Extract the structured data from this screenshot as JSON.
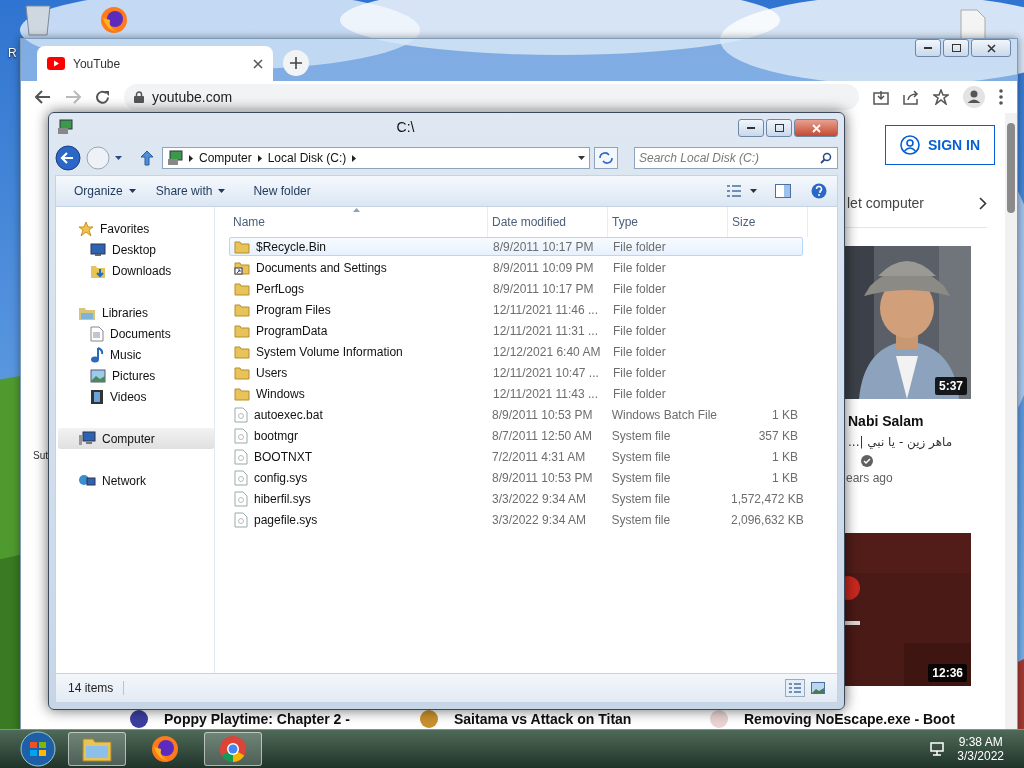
{
  "desktop": {
    "icons": [
      {
        "kind": "recycle-bin",
        "label": "R"
      },
      {
        "kind": "firefox"
      },
      {
        "kind": "document"
      }
    ]
  },
  "browser": {
    "tabs": [
      {
        "title": "YouTube",
        "selected": true
      }
    ],
    "address": "youtube.com",
    "sidebar_fragment": "Sut",
    "sign_in": "SIGN IN",
    "chip": "let computer",
    "videos": [
      {
        "kind": "portrait",
        "duration": "5:37",
        "title": "Nabi Salam",
        "subtitle": "ماهر زين - يا نبي |...",
        "verified": true,
        "meta": "ears ago"
      },
      {
        "kind": "dark",
        "duration": "12:36"
      }
    ],
    "recommendations": [
      {
        "title": "Poppy Playtime: Chapter 2 -",
        "color": "#3b3fa0"
      },
      {
        "title": "Saitama vs Attack on Titan",
        "color": "#c9912e"
      },
      {
        "title": "Removing NoEscape.exe - Boot",
        "color": "#e9d3d3"
      }
    ]
  },
  "explorer": {
    "title": "C:\\",
    "breadcrumb": [
      "Computer",
      "Local Disk (C:)"
    ],
    "search": {
      "placeholder": "Search Local Disk (C:)"
    },
    "commands": [
      {
        "label": "Organize",
        "dropdown": true
      },
      {
        "label": "Share with",
        "dropdown": true
      },
      {
        "label": "New folder",
        "dropdown": false
      }
    ],
    "nav": [
      {
        "label": "Favorites",
        "kind": "star",
        "selected": false,
        "children": [
          {
            "label": "Desktop",
            "kind": "desktop",
            "selected": false
          },
          {
            "label": "Downloads",
            "kind": "downloads",
            "selected": false
          }
        ]
      },
      {
        "label": "Libraries",
        "kind": "library",
        "selected": false,
        "children": [
          {
            "label": "Documents",
            "kind": "documents",
            "selected": false
          },
          {
            "label": "Music",
            "kind": "music",
            "selected": false
          },
          {
            "label": "Pictures",
            "kind": "pictures",
            "selected": false
          },
          {
            "label": "Videos",
            "kind": "videos",
            "selected": false
          }
        ]
      },
      {
        "label": "Computer",
        "kind": "computer",
        "selected": true
      },
      {
        "label": "Network",
        "kind": "network",
        "selected": false
      }
    ],
    "columns": [
      "Name",
      "Date modified",
      "Type",
      "Size"
    ],
    "rows": [
      {
        "kind": "folder",
        "name": "$Recycle.Bin",
        "date": "8/9/2011 10:17 PM",
        "type": "File folder",
        "selected": true
      },
      {
        "kind": "shortcut",
        "name": "Documents and Settings",
        "date": "8/9/2011 10:09 PM",
        "type": "File folder",
        "selected": false
      },
      {
        "kind": "folder",
        "name": "PerfLogs",
        "date": "8/9/2011 10:17 PM",
        "type": "File folder",
        "selected": false
      },
      {
        "kind": "folder",
        "name": "Program Files",
        "date": "12/11/2021 11:46 ...",
        "type": "File folder",
        "selected": false
      },
      {
        "kind": "folder",
        "name": "ProgramData",
        "date": "12/11/2021 11:31 ...",
        "type": "File folder",
        "selected": false
      },
      {
        "kind": "folder",
        "name": "System Volume Information",
        "date": "12/12/2021 6:40 AM",
        "type": "File folder",
        "selected": false
      },
      {
        "kind": "folder",
        "name": "Users",
        "date": "12/11/2021 10:47 ...",
        "type": "File folder",
        "selected": false
      },
      {
        "kind": "folder",
        "name": "Windows",
        "date": "12/11/2021 11:43 ...",
        "type": "File folder",
        "selected": false
      },
      {
        "kind": "file",
        "name": "autoexec.bat",
        "date": "8/9/2011 10:53 PM",
        "type": "Windows Batch File",
        "size": "1 KB",
        "selected": false
      },
      {
        "kind": "file",
        "name": "bootmgr",
        "date": "8/7/2011 12:50 AM",
        "type": "System file",
        "size": "357 KB",
        "selected": false
      },
      {
        "kind": "file",
        "name": "BOOTNXT",
        "date": "7/2/2011 4:31 AM",
        "type": "System file",
        "size": "1 KB",
        "selected": false
      },
      {
        "kind": "file",
        "name": "config.sys",
        "date": "8/9/2011 10:53 PM",
        "type": "System file",
        "size": "1 KB",
        "selected": false
      },
      {
        "kind": "file",
        "name": "hiberfil.sys",
        "date": "3/3/2022 9:34 AM",
        "type": "System file",
        "size": "1,572,472 KB",
        "selected": false
      },
      {
        "kind": "file",
        "name": "pagefile.sys",
        "date": "3/3/2022 9:34 AM",
        "type": "System file",
        "size": "2,096,632 KB",
        "selected": false
      }
    ],
    "status": "14 items"
  },
  "taskbar": {
    "apps": [
      {
        "kind": "explorer",
        "active": true
      },
      {
        "kind": "firefox",
        "active": false
      },
      {
        "kind": "chrome",
        "active": true
      }
    ],
    "time": "9:38 AM",
    "date": "3/3/2022"
  }
}
